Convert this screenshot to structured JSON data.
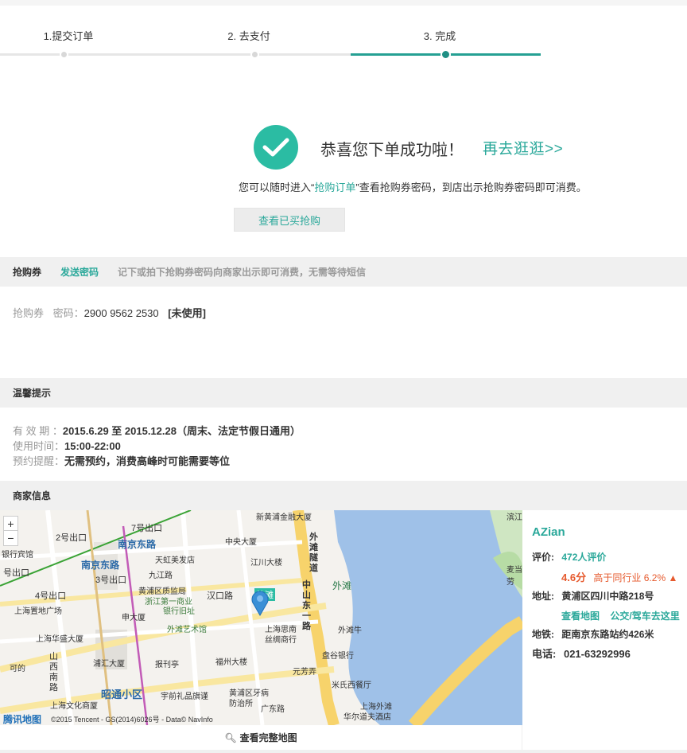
{
  "steps": [
    {
      "label": "1.提交订单"
    },
    {
      "label": "2. 去支付"
    },
    {
      "label": "3. 完成"
    }
  ],
  "success": {
    "title": "恭喜您下单成功啦！",
    "link": "再去逛逛>>",
    "desc_prefix": "您可以随时进入“",
    "desc_link": "抢购订单",
    "desc_suffix": "”查看抢购券密码，到店出示抢购券密码即可消费。",
    "button": "查看已买抢购"
  },
  "coupon": {
    "section_title": "抢购券",
    "send_password": "发送密码",
    "hint": "记下或拍下抢购券密码向商家出示即可消费，无需等待短信",
    "label": "抢购券",
    "pw_label": "密码：",
    "pw_value": "2900 9562 2530",
    "status": "[未使用]"
  },
  "tips": {
    "section_title": "温馨提示",
    "rows": [
      {
        "k": "有 效 期 ：",
        "v": "2015.6.29 至 2015.12.28（周末、法定节假日通用）"
      },
      {
        "k": "使用时间：",
        "v": "15:00-22:00"
      },
      {
        "k": "预约提醒：",
        "v": "无需预约，消费高峰时可能需要等位"
      }
    ]
  },
  "merchant": {
    "section_title": "商家信息",
    "name": "AZian",
    "rating_label": "评价:",
    "rating_count": "472人评价",
    "score": "4.6分",
    "compare": "高于同行业 6.2%",
    "address_label": "地址:",
    "address": "黄浦区四川中路218号",
    "view_map": "查看地图",
    "directions": "公交/驾车去这里",
    "subway_label": "地铁:",
    "subway": "距南京东路站约426米",
    "phone_label": "电话:",
    "phone": "021-63292996"
  },
  "map": {
    "zoom_in": "+",
    "zoom_out": "−",
    "copyright": "©2015 Tencent - GS(2014)6026号 - Data© NavInfo",
    "logo": "腾讯地图",
    "full_map": "查看完整地图",
    "labels": [
      "7号出口",
      "南京东路",
      "2号出口",
      "银行宾馆",
      "天虹美发店",
      "中央大厦",
      "江川大楼",
      "号出口",
      "南京东路",
      "3号出口",
      "九江路",
      "黄浦区质监局",
      "浙江第一商业",
      "银行旧址",
      "汉口路",
      "4号出口",
      "上海置地广场",
      "申大厦",
      "外滩艺术馆",
      "外滩",
      "上海思南",
      "丝绸商行",
      "上海华盛大厦",
      "山西南路",
      "浦汇大厦",
      "福州大楼",
      "元芳弄",
      "盘谷银行",
      "报刊亭",
      "米氏西餐厅",
      "昭通小区",
      "宇前礼品旗谨",
      "黄浦区牙病",
      "防治所",
      "广东路",
      "上海文化商厦",
      "上海外滩",
      "华尔道夫酒店",
      "外滩隧道",
      "中山东一路",
      "新黄浦金融大厦",
      "外滩",
      "外滩牛",
      "可的",
      "滨江",
      "麦当劳"
    ]
  }
}
